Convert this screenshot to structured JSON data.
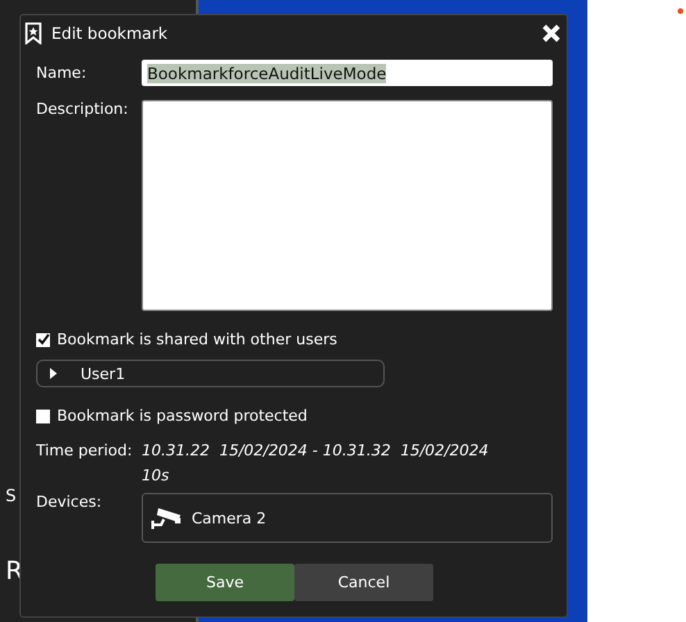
{
  "background": {
    "left_panel": {
      "texts": [
        "S",
        "R"
      ]
    }
  },
  "dialog": {
    "title": "Edit bookmark",
    "name": {
      "label": "Name:",
      "value": "BookmarkforceAuditLiveMode",
      "selected": true
    },
    "description": {
      "label": "Description:"
    },
    "shared": {
      "label": "Bookmark is shared with other users",
      "checked": true
    },
    "users": [
      {
        "label": "User1",
        "expanded": false
      }
    ],
    "password": {
      "label": "Bookmark is password protected",
      "checked": false
    },
    "time_period": {
      "label": "Time period:",
      "range": "10.31.22  15/02/2024 - 10.31.32  15/02/2024",
      "duration": "10s"
    },
    "devices": {
      "label": "Devices:",
      "items": [
        "Camera 2"
      ]
    },
    "buttons": [
      {
        "label": "Save",
        "kind": "primary"
      },
      {
        "label": "Cancel",
        "kind": "secondary"
      }
    ]
  }
}
